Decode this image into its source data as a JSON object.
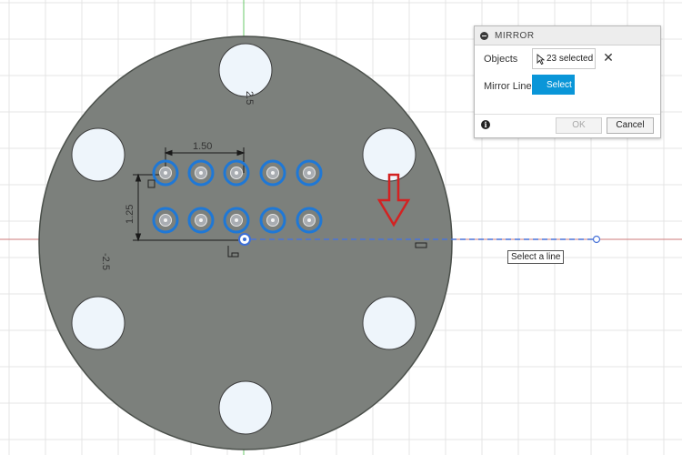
{
  "sketch": {
    "dimensions": {
      "horizontal": "1.50",
      "vertical": "1.25",
      "top_axis": "2.5",
      "left_axis": "-2.5"
    }
  },
  "mirror_dialog": {
    "title": "MIRROR",
    "objects_label": "Objects",
    "objects_value": "23 selected",
    "clear_symbol": "✕",
    "mirror_line_label": "Mirror Line",
    "select_label": "Select",
    "ok_label": "OK",
    "cancel_label": "Cancel",
    "info_symbol": "i"
  },
  "tooltip": {
    "text": "Select a line"
  },
  "colors": {
    "canvas": "#ffffff",
    "grid": "#e4e4e4",
    "plate": "#7c807c",
    "plate_edge": "#4a4f4a",
    "hole": "#eef5fb",
    "selection": "#1f78d6",
    "y_axis": "#68c868",
    "x_axis": "#cc7a7a",
    "mirror_line": "#4a74d8",
    "annotation_arrow": "#d32222",
    "select_button": "#0a96d8"
  },
  "icons": {
    "collapse": "minus-circle-icon",
    "cursor": "cursor-arrow-icon",
    "info": "info-icon",
    "clear": "close-icon"
  }
}
